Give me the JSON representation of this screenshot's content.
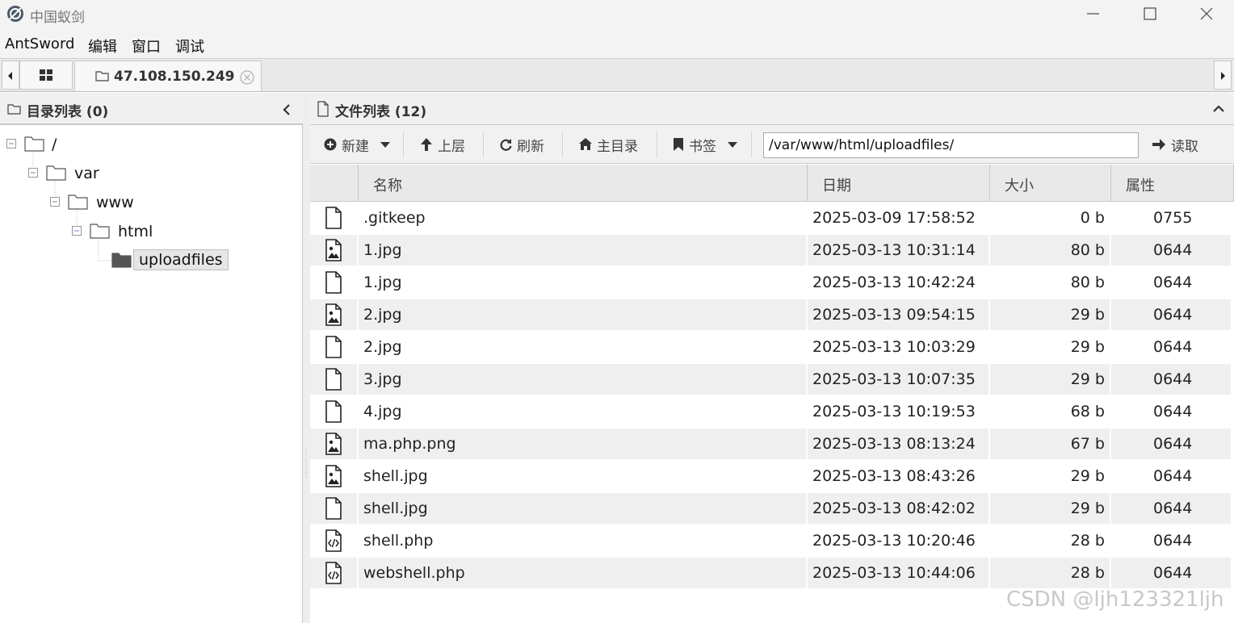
{
  "window": {
    "title": "中国蚁剑",
    "icons": {
      "app": "antsword-logo-icon",
      "minimize": "minimize-icon",
      "maximize": "maximize-icon",
      "close": "close-icon"
    }
  },
  "menu": [
    "AntSword",
    "编辑",
    "窗口",
    "调试"
  ],
  "tabs": {
    "home_icon": "grid-icon",
    "session": {
      "label": "47.108.150.249",
      "icon": "folder-outline-icon",
      "close_icon": "tab-close-icon"
    }
  },
  "left_panel": {
    "title": "目录列表 (0)",
    "collapse_icon": "chevron-left-icon",
    "tree": [
      {
        "label": "/",
        "selected": false
      },
      {
        "label": "var",
        "selected": false
      },
      {
        "label": "www",
        "selected": false
      },
      {
        "label": "html",
        "selected": false
      },
      {
        "label": "uploadfiles",
        "selected": true
      }
    ]
  },
  "right_panel": {
    "title": "文件列表 (12)",
    "collapse_icon": "chevron-up-icon",
    "toolbar": {
      "new_label": "新建",
      "up_label": "上层",
      "refresh_label": "刷新",
      "home_label": "主目录",
      "bookmark_label": "书签",
      "path_value": "/var/www/html/uploadfiles/",
      "read_label": "读取"
    },
    "columns": [
      "名称",
      "日期",
      "大小",
      "属性"
    ],
    "files": [
      {
        "icon": "file-icon",
        "name": ".gitkeep",
        "date": "2025-03-09 17:58:52",
        "size": "0 b",
        "attr": "0755"
      },
      {
        "icon": "image-file-icon",
        "name": "1.jpg",
        "date": "2025-03-13 10:31:14",
        "size": "80 b",
        "attr": "0644"
      },
      {
        "icon": "file-icon",
        "name": "1.jpg",
        "date": "2025-03-13 10:42:24",
        "size": "80 b",
        "attr": "0644"
      },
      {
        "icon": "image-file-icon",
        "name": "2.jpg",
        "date": "2025-03-13 09:54:15",
        "size": "29 b",
        "attr": "0644"
      },
      {
        "icon": "file-icon",
        "name": "2.jpg",
        "date": "2025-03-13 10:03:29",
        "size": "29 b",
        "attr": "0644"
      },
      {
        "icon": "file-icon",
        "name": "3.jpg",
        "date": "2025-03-13 10:07:35",
        "size": "29 b",
        "attr": "0644"
      },
      {
        "icon": "file-icon",
        "name": "4.jpg",
        "date": "2025-03-13 10:19:53",
        "size": "68 b",
        "attr": "0644"
      },
      {
        "icon": "image-file-icon",
        "name": "ma.php.png",
        "date": "2025-03-13 08:13:24",
        "size": "67 b",
        "attr": "0644"
      },
      {
        "icon": "image-file-icon",
        "name": "shell.jpg",
        "date": "2025-03-13 08:43:26",
        "size": "29 b",
        "attr": "0644"
      },
      {
        "icon": "file-icon",
        "name": "shell.jpg",
        "date": "2025-03-13 08:42:02",
        "size": "29 b",
        "attr": "0644"
      },
      {
        "icon": "code-file-icon",
        "name": "shell.php",
        "date": "2025-03-13 10:20:46",
        "size": "28 b",
        "attr": "0644"
      },
      {
        "icon": "code-file-icon",
        "name": "webshell.php",
        "date": "2025-03-13 10:44:06",
        "size": "28 b",
        "attr": "0644"
      }
    ]
  },
  "watermark": "CSDN @ljh123321ljh"
}
